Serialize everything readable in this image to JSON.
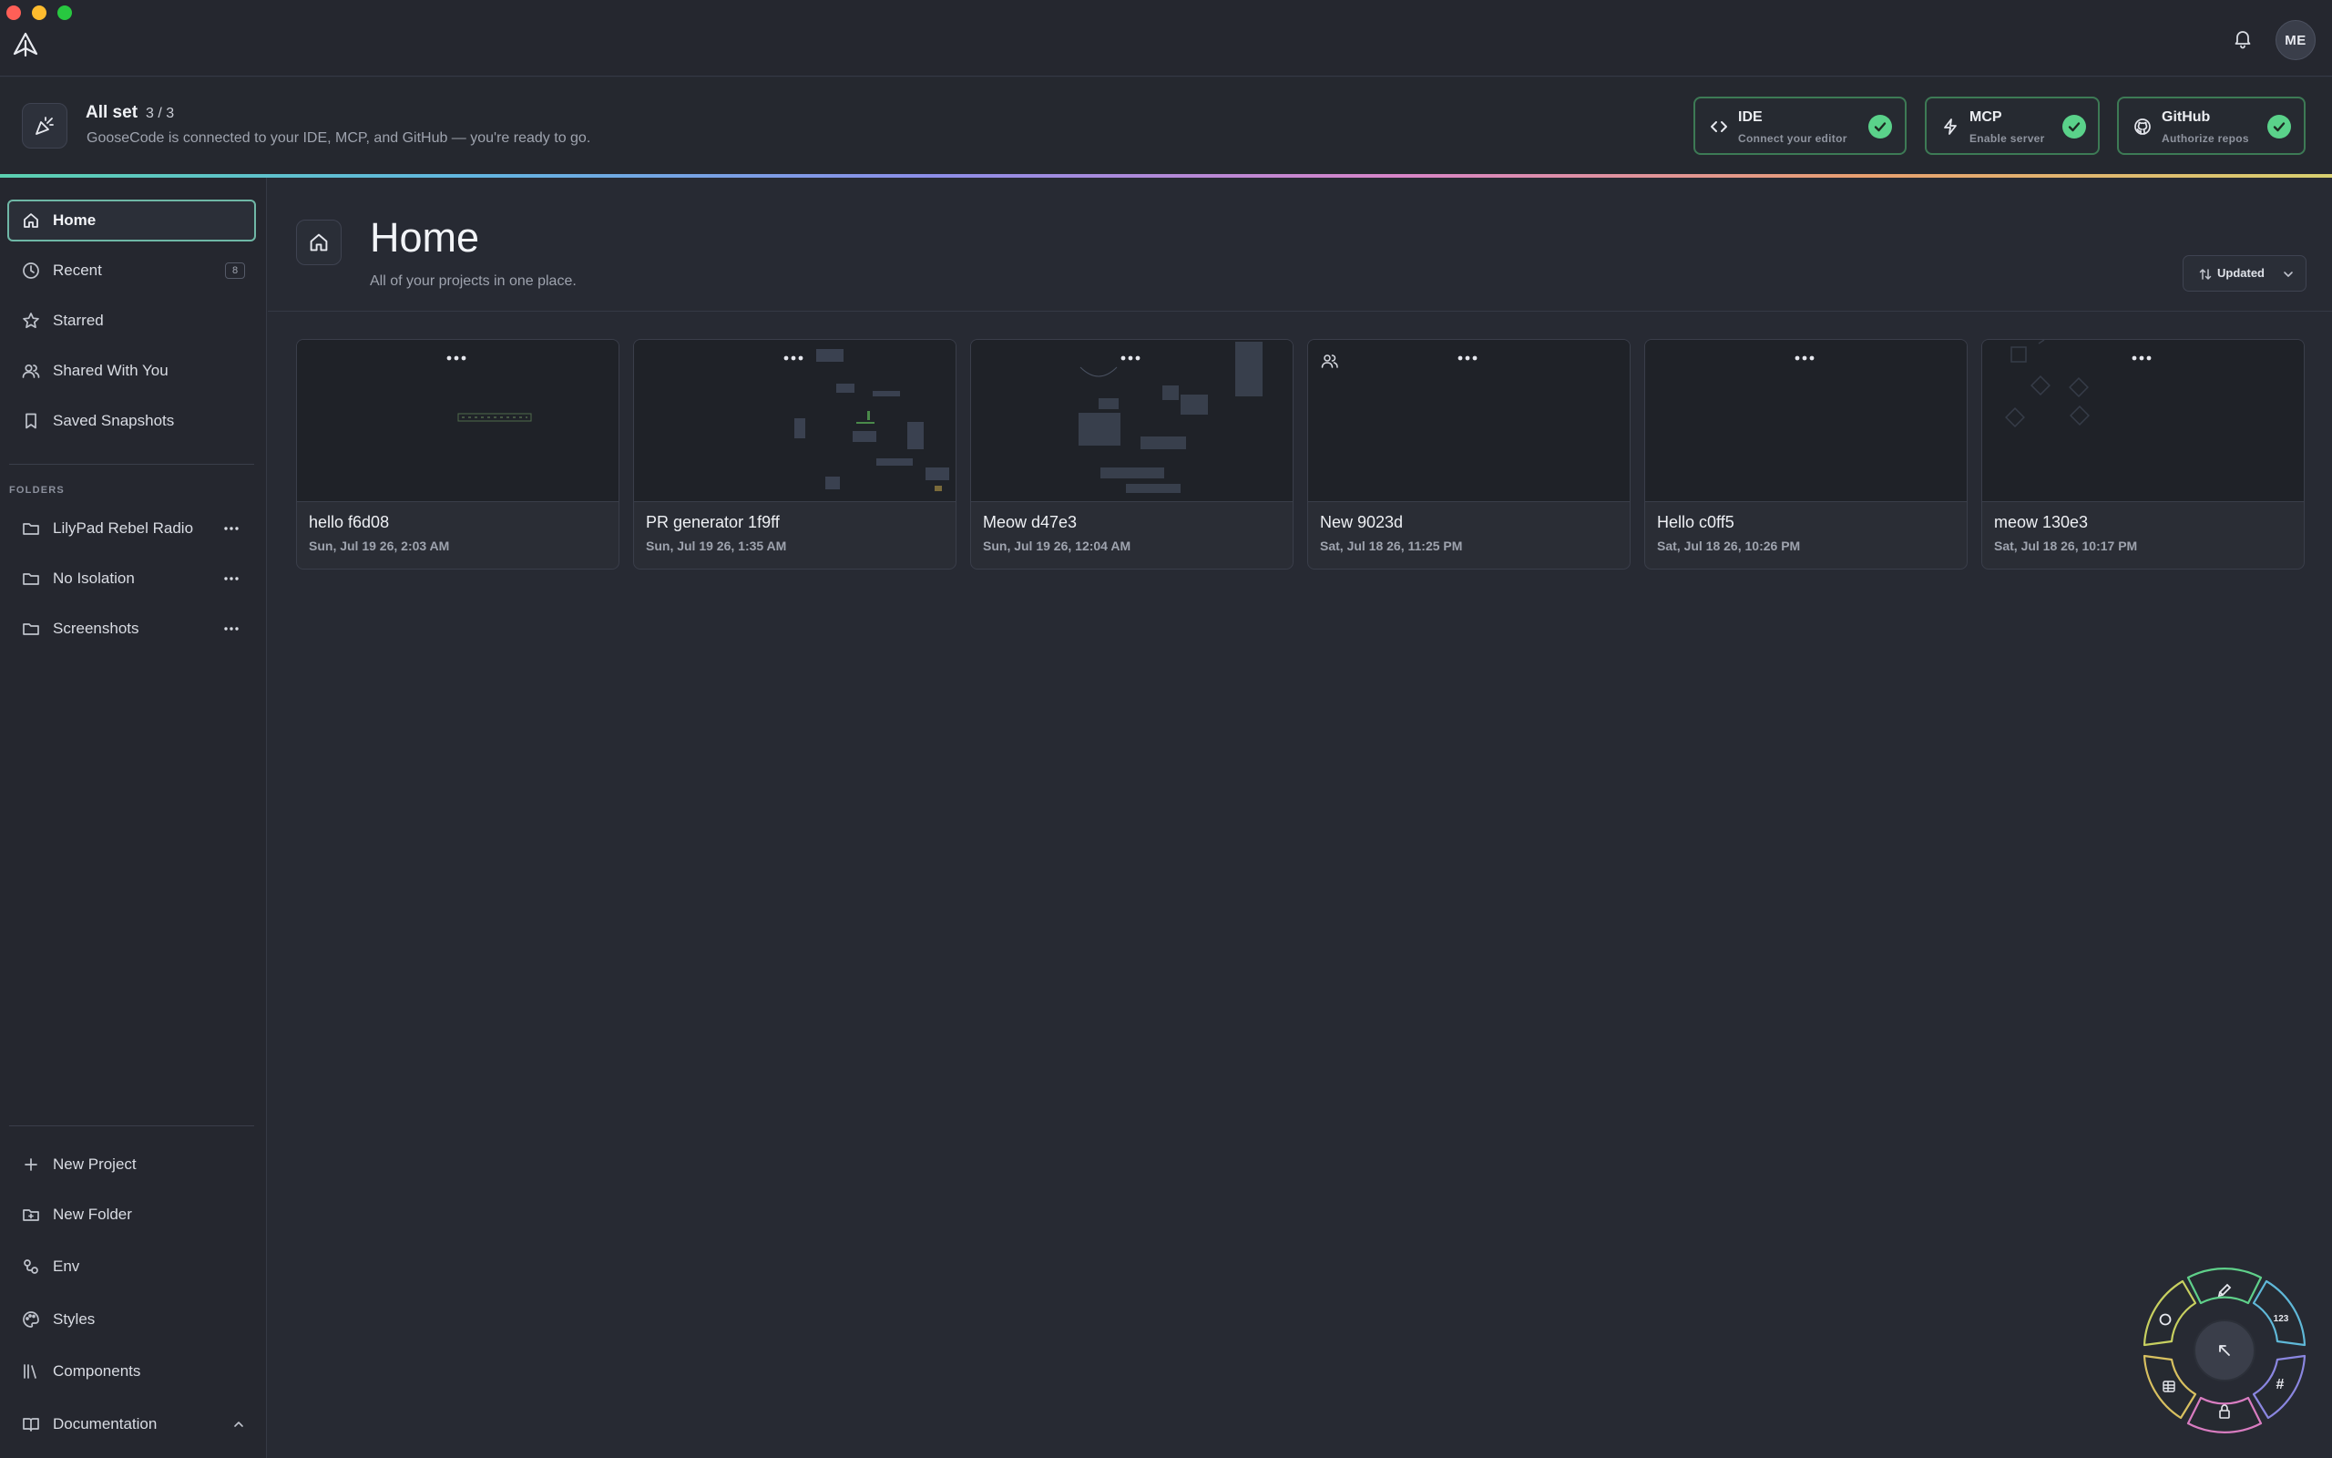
{
  "app": {
    "avatar_initials": "ME"
  },
  "banner": {
    "title": "All set",
    "count": "3 / 3",
    "subtitle": "GooseCode is connected to your IDE, MCP, and GitHub — you're ready to go.",
    "chips": [
      {
        "title": "IDE",
        "subtitle": "Connect your editor",
        "icon": "code-icon",
        "status": "connected"
      },
      {
        "title": "MCP",
        "subtitle": "Enable server",
        "icon": "bolt-icon",
        "status": "connected"
      },
      {
        "title": "GitHub",
        "subtitle": "Authorize repos",
        "icon": "github-icon",
        "status": "connected"
      }
    ]
  },
  "sidebar": {
    "nav": [
      {
        "label": "Home",
        "icon": "home-icon",
        "active": true
      },
      {
        "label": "Recent",
        "icon": "clock-icon",
        "badge": "8"
      },
      {
        "label": "Starred",
        "icon": "star-icon"
      },
      {
        "label": "Shared With You",
        "icon": "users-icon"
      },
      {
        "label": "Saved Snapshots",
        "icon": "bookmark-icon"
      }
    ],
    "folders_label": "FOLDERS",
    "folders": [
      {
        "label": "LilyPad Rebel Radio",
        "icon": "folder-icon"
      },
      {
        "label": "No Isolation",
        "icon": "folder-icon"
      },
      {
        "label": "Screenshots",
        "icon": "folder-icon"
      }
    ],
    "bottom": [
      {
        "label": "New Project",
        "icon": "plus-icon"
      },
      {
        "label": "New Folder",
        "icon": "folder-plus-icon"
      },
      {
        "label": "Env",
        "icon": "env-icon"
      },
      {
        "label": "Styles",
        "icon": "palette-icon"
      },
      {
        "label": "Components",
        "icon": "library-icon"
      },
      {
        "label": "Documentation",
        "icon": "book-icon"
      }
    ]
  },
  "main": {
    "title": "Home",
    "subtitle": "All of your projects in one place.",
    "sort_label": "Updated",
    "projects": [
      {
        "title": "hello f6d08",
        "date": "Sun, Jul 19 26, 2:03 AM",
        "shared": false
      },
      {
        "title": "PR generator 1f9ff",
        "date": "Sun, Jul 19 26, 1:35 AM",
        "shared": false
      },
      {
        "title": "Meow d47e3",
        "date": "Sun, Jul 19 26, 12:04 AM",
        "shared": false
      },
      {
        "title": "New 9023d",
        "date": "Sat, Jul 18 26, 11:25 PM",
        "shared": true
      },
      {
        "title": "Hello c0ff5",
        "date": "Sat, Jul 18 26, 10:26 PM",
        "shared": false
      },
      {
        "title": "meow 130e3",
        "date": "Sat, Jul 18 26, 10:17 PM",
        "shared": false
      }
    ]
  },
  "tool_wheel": {
    "center_icon": "arrow-up-left-icon",
    "segments": [
      {
        "icon": "pencil-icon",
        "color": "#5fd08a"
      },
      {
        "icon": "number-icon",
        "label": "123",
        "color": "#5fb8d8"
      },
      {
        "icon": "hash-icon",
        "label": "#",
        "color": "#8a86e0"
      },
      {
        "icon": "lock-icon",
        "color": "#d87cc0"
      },
      {
        "icon": "table-icon",
        "color": "#d8c060"
      },
      {
        "icon": "circle-icon",
        "color": "#c8d060"
      }
    ]
  }
}
